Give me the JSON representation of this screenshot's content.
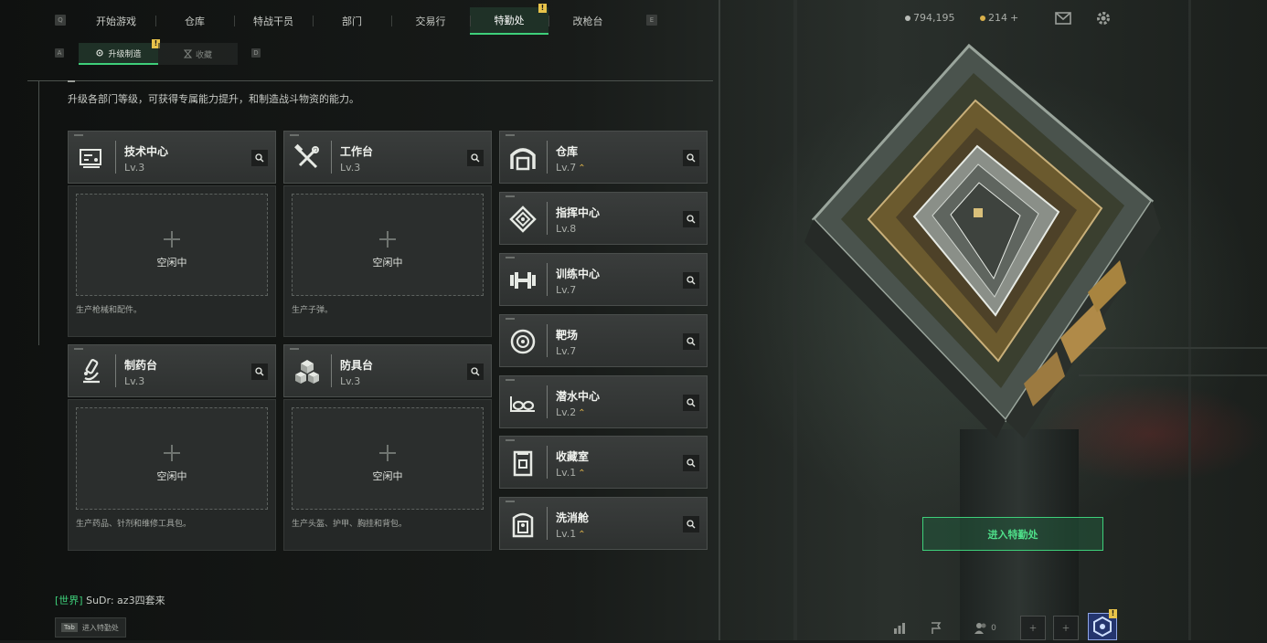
{
  "nav": {
    "key_left": "Q",
    "key_right": "E",
    "tabs": [
      {
        "label": "开始游戏"
      },
      {
        "label": "仓库"
      },
      {
        "label": "特战干员"
      },
      {
        "label": "部门"
      },
      {
        "label": "交易行"
      },
      {
        "label": "特勤处",
        "active": true,
        "badge": "!"
      },
      {
        "label": "改枪台"
      }
    ]
  },
  "subnav": {
    "key_left": "A",
    "key_right": "D",
    "upgrade": "升级制造",
    "upgrade_badge": "!",
    "collect": "收藏"
  },
  "header": {
    "currency_1": "794,195",
    "currency_2": "214",
    "currency_2_plus": "+"
  },
  "description": "升级各部门等级，可获得专属能力提升，和制造战斗物资的能力。",
  "production": [
    {
      "name": "技术中心",
      "level": "Lv.3",
      "icon": "circuit-board-icon",
      "state": "空闲中",
      "note": "生产枪械和配件。"
    },
    {
      "name": "工作台",
      "level": "Lv.3",
      "icon": "tools-icon",
      "state": "空闲中",
      "note": "生产子弹。"
    },
    {
      "name": "制药台",
      "level": "Lv.3",
      "icon": "microscope-icon",
      "state": "空闲中",
      "note": "生产药品、针剂和维修工具包。"
    },
    {
      "name": "防具台",
      "level": "Lv.3",
      "icon": "armor-blocks-icon",
      "state": "空闲中",
      "note": "生产头盔、护甲、胸挂和背包。"
    }
  ],
  "facilities": [
    {
      "name": "仓库",
      "level": "Lv.7",
      "upgradable": true,
      "icon": "warehouse-icon"
    },
    {
      "name": "指挥中心",
      "level": "Lv.8",
      "upgradable": false,
      "icon": "command-chip-icon"
    },
    {
      "name": "训练中心",
      "level": "Lv.7",
      "upgradable": false,
      "icon": "dumbbell-icon"
    },
    {
      "name": "靶场",
      "level": "Lv.7",
      "upgradable": false,
      "icon": "target-icon"
    },
    {
      "name": "潜水中心",
      "level": "Lv.2",
      "upgradable": true,
      "icon": "diving-goggles-icon"
    },
    {
      "name": "收藏室",
      "level": "Lv.1",
      "upgradable": true,
      "icon": "collection-cabinet-icon"
    },
    {
      "name": "洗消舱",
      "level": "Lv.1",
      "upgradable": true,
      "icon": "decontamination-pod-icon"
    }
  ],
  "enter_button": "进入特勤处",
  "chat": {
    "channel": "[世界]",
    "message": "SuDr: az3四套来"
  },
  "tab_hint": {
    "key": "Tab",
    "label": "进入特勤处"
  },
  "bottom_bar": {
    "friends_count": "0",
    "avatar_badge": "!"
  },
  "colors": {
    "accent": "#3ecf7a",
    "badge": "#e8c34a",
    "upgrade": "#d9b04a"
  }
}
